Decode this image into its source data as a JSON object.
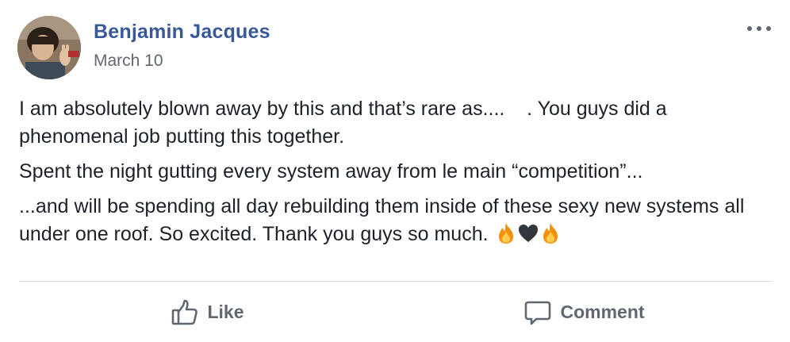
{
  "post": {
    "author": "Benjamin Jacques",
    "date": "March 10",
    "more_icon": "more-options-icon",
    "paragraphs": [
      "I am absolutely blown away by this and that’s rare as....    . You guys did a phenomenal job putting this together.",
      "Spent the night gutting every system away from le main “competition”...",
      "...and will be spending all day rebuilding them inside of these sexy new systems all under one roof. So excited. Thank you guys so much."
    ],
    "emojis": [
      "fire-emoji",
      "black-heart-emoji",
      "fire-emoji"
    ]
  },
  "actions": {
    "like_label": "Like",
    "like_icon": "thumbs-up-icon",
    "comment_label": "Comment",
    "comment_icon": "speech-bubble-icon"
  },
  "colors": {
    "author": "#385898",
    "secondary_text": "#616770",
    "body_text": "#1d2129",
    "divider": "#dadde1"
  }
}
